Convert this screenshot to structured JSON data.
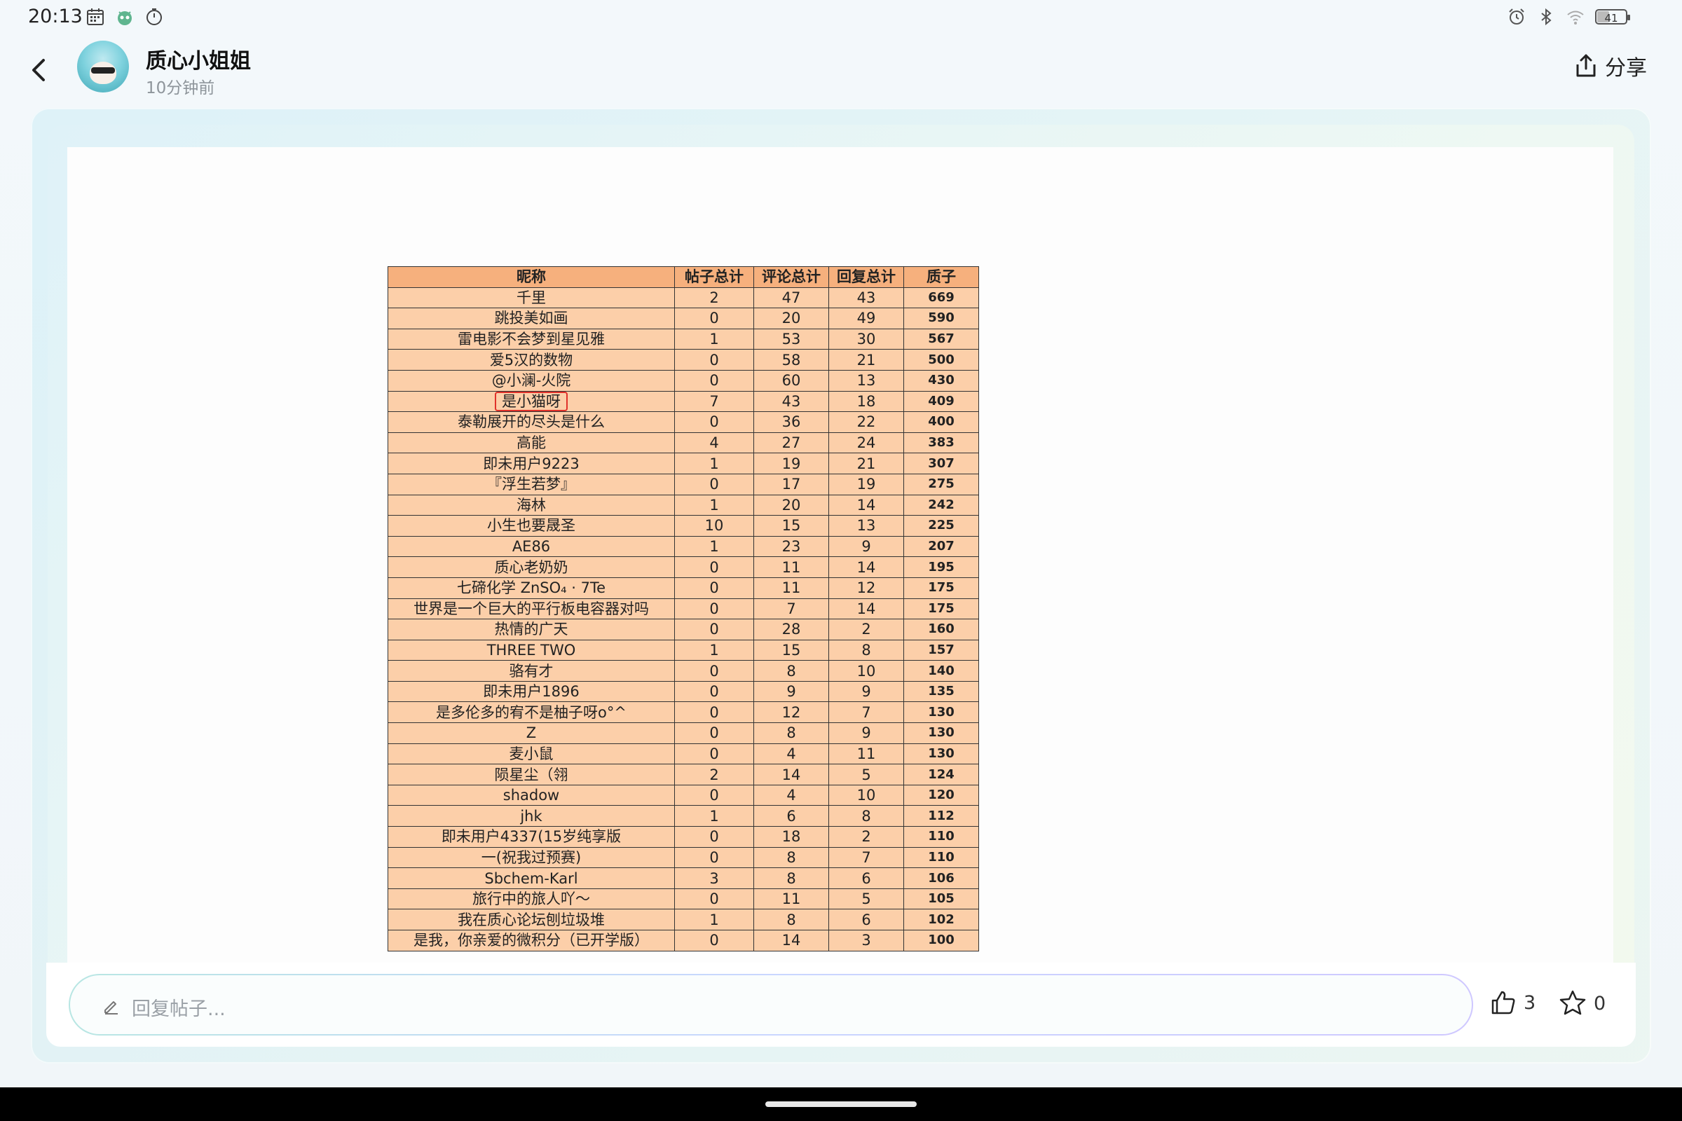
{
  "status_bar": {
    "time": "20:13",
    "left_icons": [
      "calendar-icon",
      "robot-icon",
      "timer-icon"
    ],
    "right_icons": [
      "alarm-icon",
      "bluetooth-icon",
      "wifi-icon",
      "battery-icon"
    ],
    "battery_level": "41"
  },
  "header": {
    "author_name": "质心小姐姐",
    "post_time": "10分钟前",
    "share_label": "分享"
  },
  "table": {
    "headers": [
      "昵称",
      "帖子总计",
      "评论总计",
      "回复总计",
      "质子"
    ],
    "highlighted_row": 5,
    "rows": [
      [
        "千里",
        "2",
        "47",
        "43",
        "669"
      ],
      [
        "跳投美如画",
        "0",
        "20",
        "49",
        "590"
      ],
      [
        "雷电影不会梦到星见雅",
        "1",
        "53",
        "30",
        "567"
      ],
      [
        "爱5汉的数物",
        "0",
        "58",
        "21",
        "500"
      ],
      [
        "@小澜-火院",
        "0",
        "60",
        "13",
        "430"
      ],
      [
        "是小猫呀",
        "7",
        "43",
        "18",
        "409"
      ],
      [
        "泰勒展开的尽头是什么",
        "0",
        "36",
        "22",
        "400"
      ],
      [
        "高能",
        "4",
        "27",
        "24",
        "383"
      ],
      [
        "即未用户9223",
        "1",
        "19",
        "21",
        "307"
      ],
      [
        "『浮生若梦』",
        "0",
        "17",
        "19",
        "275"
      ],
      [
        "海林",
        "1",
        "20",
        "14",
        "242"
      ],
      [
        "小生也要晟圣",
        "10",
        "15",
        "13",
        "225"
      ],
      [
        "AE86",
        "1",
        "23",
        "9",
        "207"
      ],
      [
        "质心老奶奶",
        "0",
        "11",
        "14",
        "195"
      ],
      [
        "七碲化学 ZnSO₄ · 7Te",
        "0",
        "11",
        "12",
        "175"
      ],
      [
        "世界是一个巨大的平行板电容器对吗",
        "0",
        "7",
        "14",
        "175"
      ],
      [
        "热情的广天",
        "0",
        "28",
        "2",
        "160"
      ],
      [
        "THREE TWO",
        "1",
        "15",
        "8",
        "157"
      ],
      [
        "骆有才",
        "0",
        "8",
        "10",
        "140"
      ],
      [
        "即未用户1896",
        "0",
        "9",
        "9",
        "135"
      ],
      [
        "是多伦多的宥不是柚子呀o°^",
        "0",
        "12",
        "7",
        "130"
      ],
      [
        "Z",
        "0",
        "8",
        "9",
        "130"
      ],
      [
        "麦小鼠",
        "0",
        "4",
        "11",
        "130"
      ],
      [
        "陨星尘（翎",
        "2",
        "14",
        "5",
        "124"
      ],
      [
        "shadow",
        "0",
        "4",
        "10",
        "120"
      ],
      [
        "jhk",
        "1",
        "6",
        "8",
        "112"
      ],
      [
        "即未用户4337(15岁纯享版",
        "0",
        "18",
        "2",
        "110"
      ],
      [
        "一(祝我过预赛)",
        "0",
        "8",
        "7",
        "110"
      ],
      [
        "Sbchem-Karl",
        "3",
        "8",
        "6",
        "106"
      ],
      [
        "旅行中的旅人吖～",
        "0",
        "11",
        "5",
        "105"
      ],
      [
        "我在质心论坛刨垃圾堆",
        "1",
        "8",
        "6",
        "102"
      ],
      [
        "是我，你亲爱的微积分（已开学版）",
        "0",
        "14",
        "3",
        "100"
      ]
    ]
  },
  "bottom": {
    "reply_placeholder": "回复帖子...",
    "like_count": "3",
    "fav_count": "0"
  }
}
